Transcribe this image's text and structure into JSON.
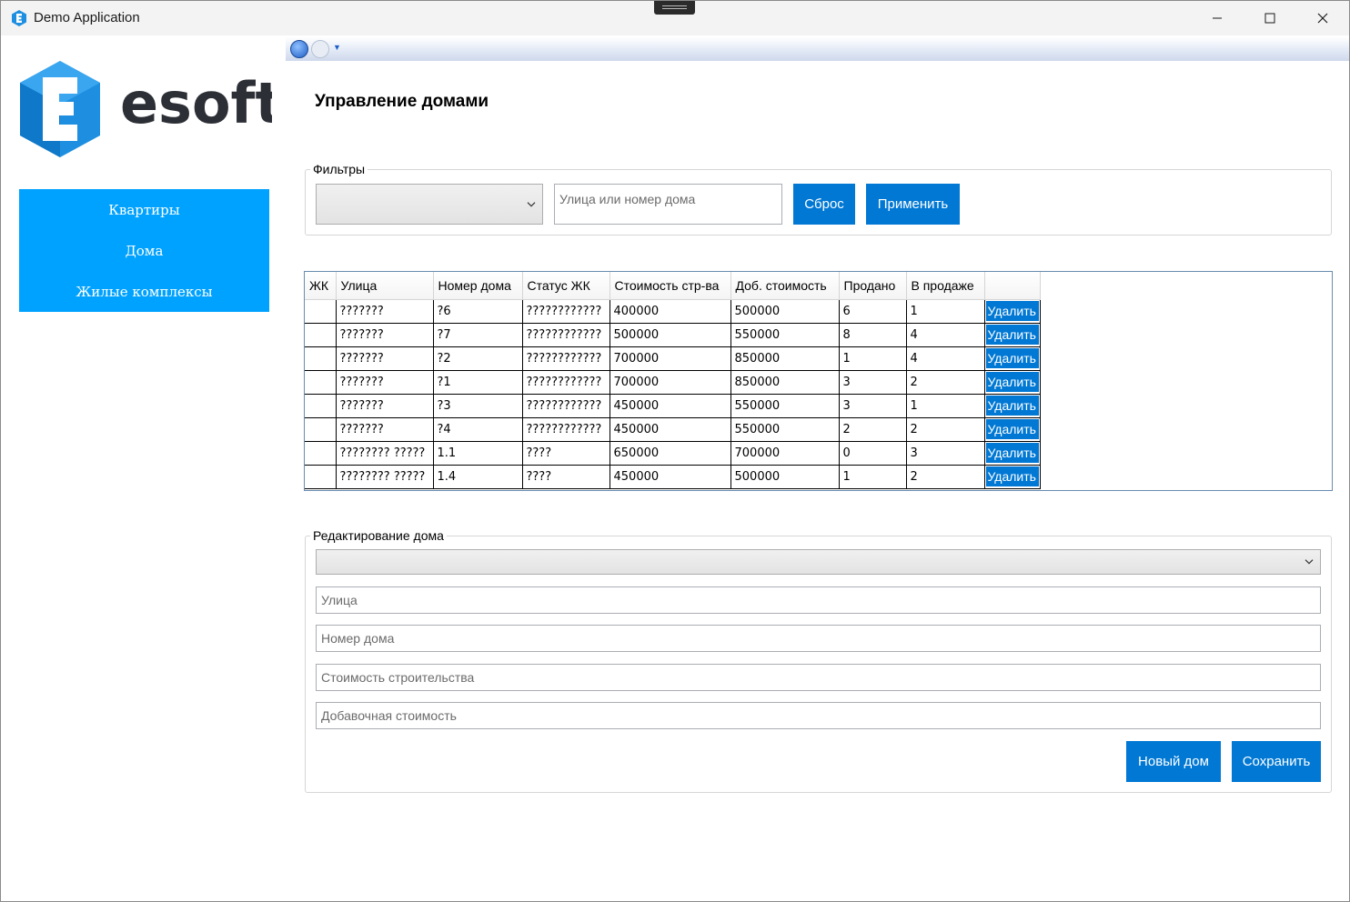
{
  "window": {
    "title": "Demo Application",
    "minimize_label": "—",
    "maximize_label": "☐",
    "close_label": "✕"
  },
  "brand": {
    "logo_text": "esoft",
    "logo_letter": "E",
    "accent": "#00a2ff",
    "button_blue": "#0078d4"
  },
  "sidebar": {
    "items": [
      {
        "label": "Квартиры"
      },
      {
        "label": "Дома"
      },
      {
        "label": "Жилые комплексы"
      }
    ]
  },
  "page": {
    "title": "Управление домами"
  },
  "filters": {
    "group_label": "Фильтры",
    "complex_select_value": "",
    "search_placeholder": "Улица или номер дома",
    "reset_label": "Сброс",
    "apply_label": "Применить"
  },
  "table": {
    "columns": [
      "ЖК",
      "Улица",
      "Номер дома",
      "Статус ЖК",
      "Стоимость стр-ва",
      "Доб. стоимость",
      "Продано",
      "В продаже",
      ""
    ],
    "delete_label": "Удалить",
    "rows": [
      {
        "complex": "",
        "street": "???????",
        "number": "?6",
        "status": "????????????",
        "cost": "400000",
        "extra": "500000",
        "sold": "6",
        "on_sale": "1"
      },
      {
        "complex": "",
        "street": "???????",
        "number": "?7",
        "status": "????????????",
        "cost": "500000",
        "extra": "550000",
        "sold": "8",
        "on_sale": "4"
      },
      {
        "complex": "",
        "street": "???????",
        "number": "?2",
        "status": "????????????",
        "cost": "700000",
        "extra": "850000",
        "sold": "1",
        "on_sale": "4"
      },
      {
        "complex": "",
        "street": "???????",
        "number": "?1",
        "status": "????????????",
        "cost": "700000",
        "extra": "850000",
        "sold": "3",
        "on_sale": "2"
      },
      {
        "complex": "",
        "street": "???????",
        "number": "?3",
        "status": "????????????",
        "cost": "450000",
        "extra": "550000",
        "sold": "3",
        "on_sale": "1"
      },
      {
        "complex": "",
        "street": "???????",
        "number": "?4",
        "status": "????????????",
        "cost": "450000",
        "extra": "550000",
        "sold": "2",
        "on_sale": "2"
      },
      {
        "complex": "",
        "street": "???????? ?????",
        "number": "1.1",
        "status": "????",
        "cost": "650000",
        "extra": "700000",
        "sold": "0",
        "on_sale": "3"
      },
      {
        "complex": "",
        "street": "???????? ?????",
        "number": "1.4",
        "status": "????",
        "cost": "450000",
        "extra": "500000",
        "sold": "1",
        "on_sale": "2"
      }
    ]
  },
  "edit": {
    "group_label": "Редактирование дома",
    "complex_select_value": "",
    "street_placeholder": "Улица",
    "number_placeholder": "Номер дома",
    "cost_placeholder": "Стоимость строительства",
    "extra_placeholder": "Добавочная стоимость",
    "new_label": "Новый дом",
    "save_label": "Сохранить"
  }
}
